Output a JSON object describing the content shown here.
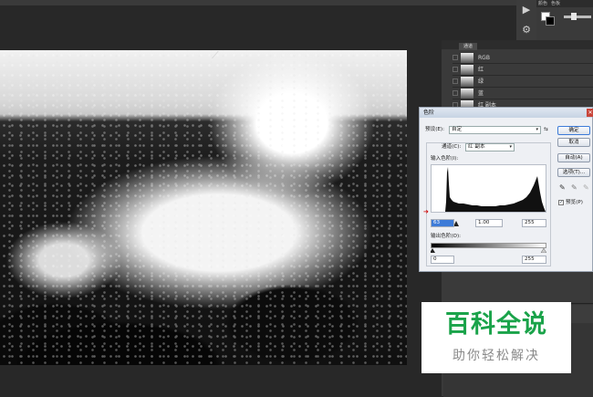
{
  "color_panel": {
    "tabs": [
      "颜色",
      "色板"
    ]
  },
  "channels_panel": {
    "tab": "通道",
    "channels": [
      {
        "label": "RGB"
      },
      {
        "label": "红"
      },
      {
        "label": "绿"
      },
      {
        "label": "蓝"
      },
      {
        "label": "红 副本"
      }
    ]
  },
  "levels_dialog": {
    "title": "色阶",
    "preset_label": "预设(E):",
    "preset_value": "自定",
    "channel_label": "通道(C):",
    "channel_value": "红 副本",
    "input_levels_label": "输入色阶(I):",
    "input_black": "63",
    "input_gamma": "1.00",
    "input_white": "255",
    "output_levels_label": "输出色阶(O):",
    "output_black": "0",
    "output_white": "255",
    "buttons": {
      "ok": "确定",
      "cancel": "取消",
      "auto": "自动(A)",
      "options": "选项(T)..."
    },
    "preview_label": "预览(P)",
    "preview_checked": true
  },
  "watermark": {
    "title": "百科全说",
    "subtitle": "助你轻松解决"
  },
  "colors": {
    "workspace": "#282828",
    "panel": "#3a3a3a",
    "dialog": "#eef0f4",
    "watermark_green": "#1aa34a",
    "arrow_red": "#d40000"
  }
}
